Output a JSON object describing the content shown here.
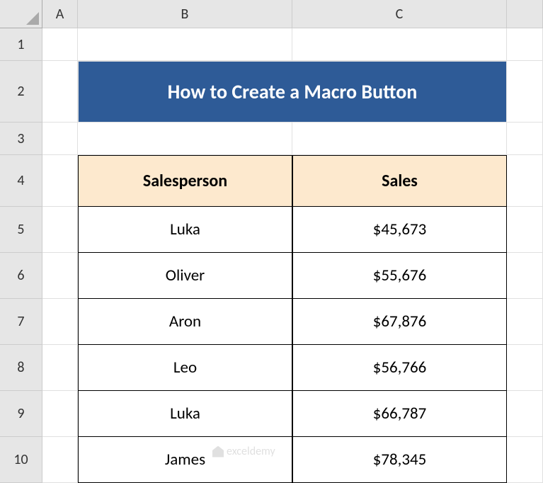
{
  "columns": [
    "A",
    "B",
    "C"
  ],
  "rows": [
    "1",
    "2",
    "3",
    "4",
    "5",
    "6",
    "7",
    "8",
    "9",
    "10"
  ],
  "title": "How to Create a Macro Button",
  "table": {
    "headers": [
      "Salesperson",
      "Sales"
    ],
    "data": [
      {
        "name": "Luka",
        "sales": "$45,673"
      },
      {
        "name": "Oliver",
        "sales": "$55,676"
      },
      {
        "name": "Aron",
        "sales": "$67,876"
      },
      {
        "name": "Leo",
        "sales": "$56,766"
      },
      {
        "name": "Luka",
        "sales": "$66,787"
      },
      {
        "name": "James",
        "sales": "$78,345"
      }
    ]
  },
  "watermark": "exceldemy",
  "chart_data": {
    "type": "table",
    "title": "How to Create a Macro Button",
    "columns": [
      "Salesperson",
      "Sales"
    ],
    "rows": [
      [
        "Luka",
        45673
      ],
      [
        "Oliver",
        55676
      ],
      [
        "Aron",
        67876
      ],
      [
        "Leo",
        56766
      ],
      [
        "Luka",
        66787
      ],
      [
        "James",
        78345
      ]
    ]
  }
}
